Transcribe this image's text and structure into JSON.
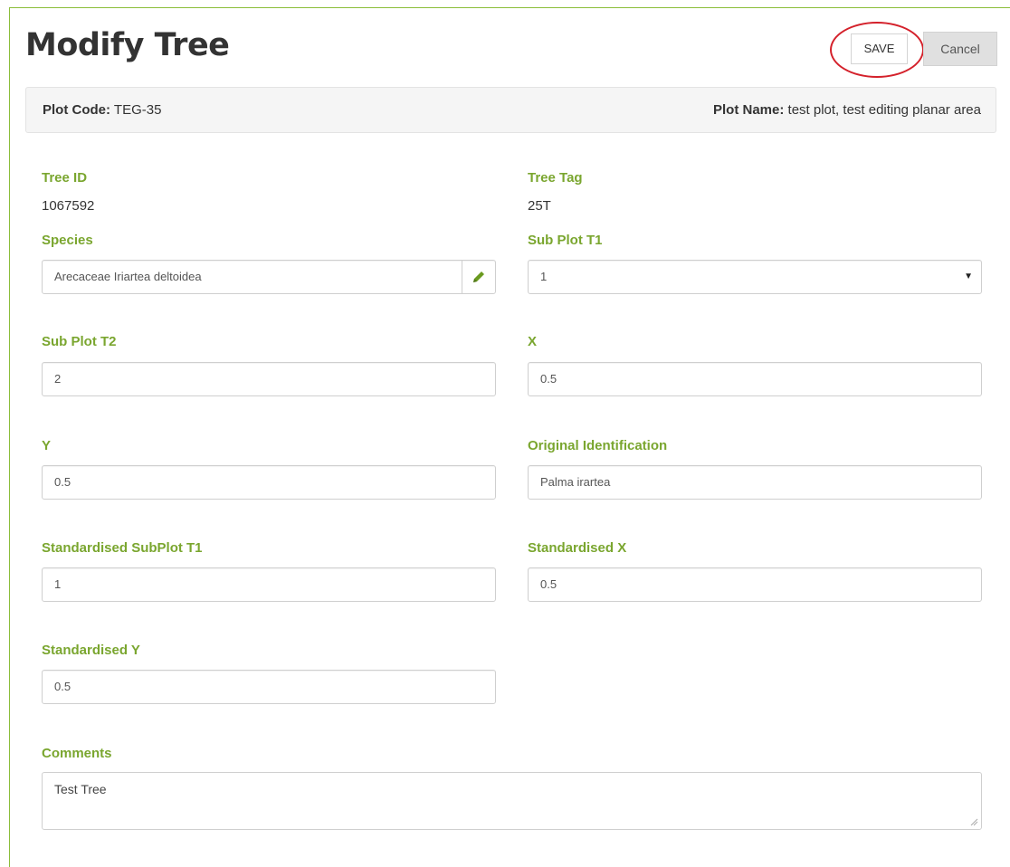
{
  "page": {
    "title": "Modify Tree"
  },
  "toolbar": {
    "save_label": "SAVE",
    "cancel_label": "Cancel",
    "annotation_color": "#d4212b"
  },
  "plot": {
    "code_label": "Plot Code:",
    "code_value": "TEG-35",
    "name_label": "Plot Name:",
    "name_value": "test plot, test editing planar area"
  },
  "fields": {
    "tree_id": {
      "label": "Tree ID",
      "value": "1067592"
    },
    "tree_tag": {
      "label": "Tree Tag",
      "value": "25T"
    },
    "species": {
      "label": "Species",
      "value": "Arecaceae Iriartea deltoidea",
      "edit_icon": "pencil-icon"
    },
    "sub_plot_t1": {
      "label": "Sub Plot T1",
      "value": "1"
    },
    "sub_plot_t2": {
      "label": "Sub Plot T2",
      "value": "2"
    },
    "x": {
      "label": "X",
      "value": "0.5"
    },
    "y": {
      "label": "Y",
      "value": "0.5"
    },
    "original_identification": {
      "label": "Original Identification",
      "value": "Palma irartea"
    },
    "standardised_subplot_t1": {
      "label": "Standardised SubPlot T1",
      "value": "1"
    },
    "standardised_x": {
      "label": "Standardised X",
      "value": "0.5"
    },
    "standardised_y": {
      "label": "Standardised Y",
      "value": "0.5"
    },
    "comments": {
      "label": "Comments",
      "value": "Test Tree"
    }
  },
  "colors": {
    "label_green": "#7aa62f",
    "frame_green": "#8bbd3a",
    "pencil_green": "#6a9a1f"
  }
}
